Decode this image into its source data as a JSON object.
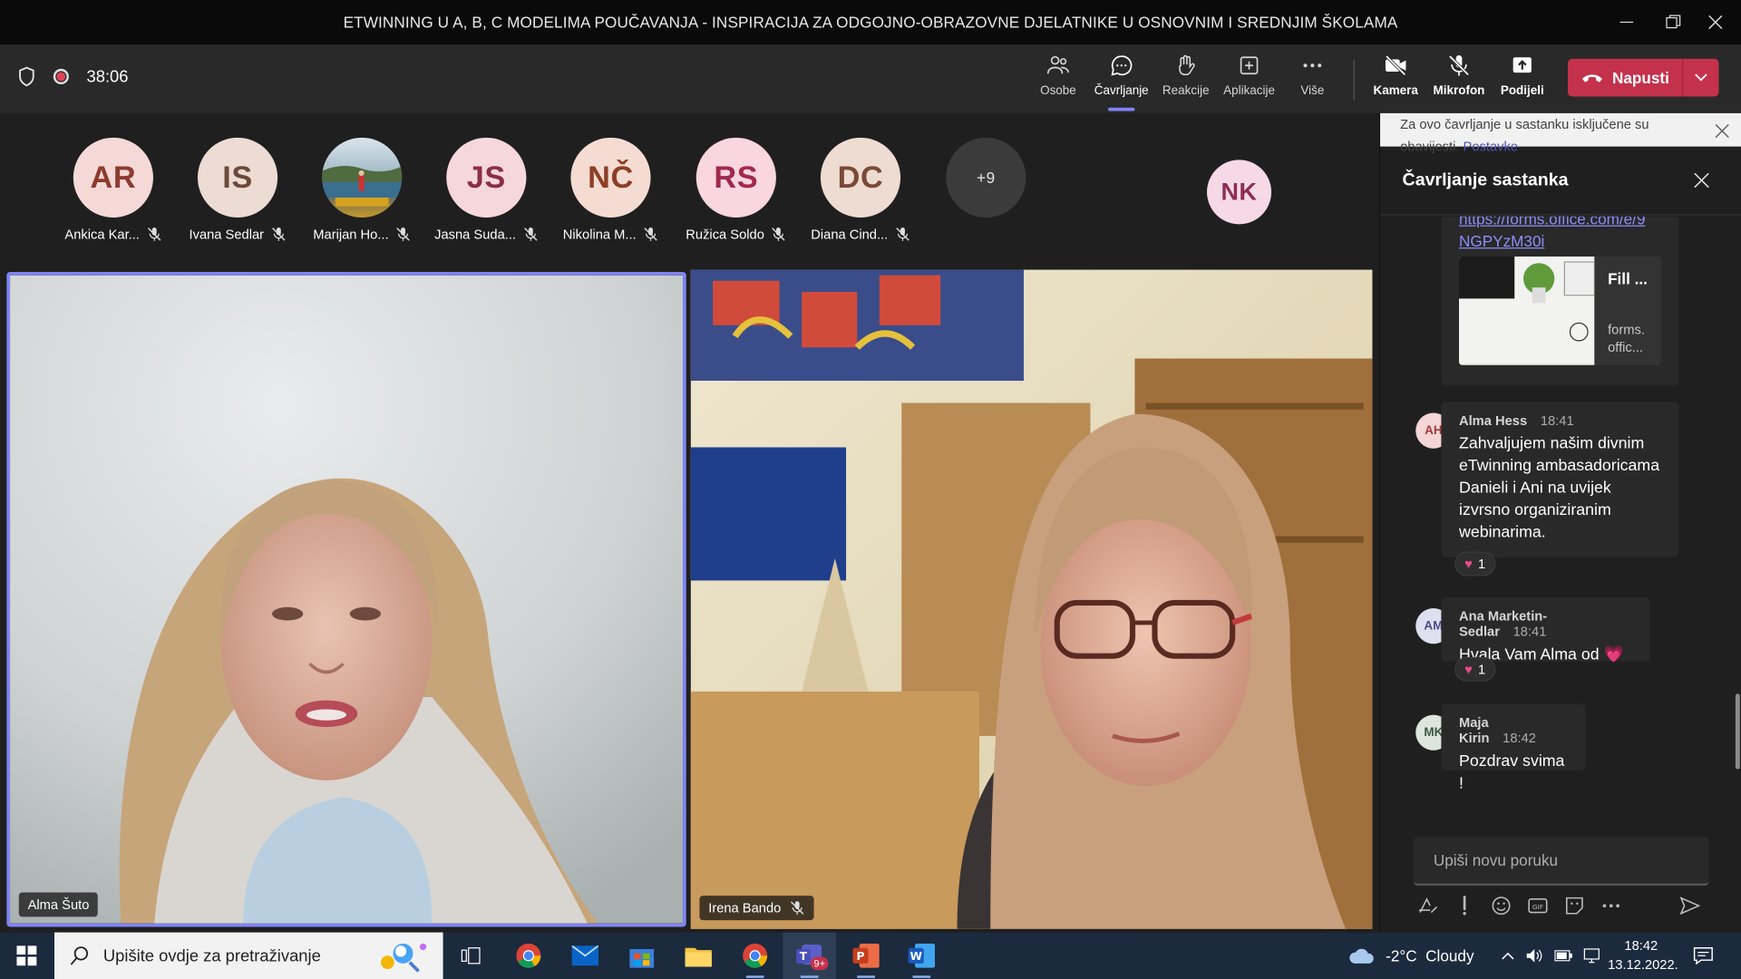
{
  "window": {
    "title": "ETWINNING U A, B, C MODELIMA POUČAVANJA - INSPIRACIJA ZA ODGOJNO-OBRAZOVNE DJELATNIKE U OSNOVNIM I SREDNJIM ŠKOLAMA"
  },
  "meeting": {
    "timer": "38:06"
  },
  "toolbar": {
    "people": "Osobe",
    "chat": "Čavrljanje",
    "reactions": "Reakcije",
    "apps": "Aplikacije",
    "more": "Više",
    "camera": "Kamera",
    "mic": "Mikrofon",
    "share": "Podijeli",
    "leave": "Napusti"
  },
  "participants": [
    {
      "initials": "AR",
      "name": "Ankica Kar...",
      "bg": "#f4d9d6",
      "fg": "#8e3a2f"
    },
    {
      "initials": "IS",
      "name": "Ivana Sedlar",
      "bg": "#ecdcd3",
      "fg": "#6b4a3a"
    },
    {
      "initials": "",
      "name": "Marijan Ho...",
      "bg": "#6a7e8c",
      "fg": "#ffffff"
    },
    {
      "initials": "JS",
      "name": "Jasna Suda...",
      "bg": "#f6d8dc",
      "fg": "#8a2f46"
    },
    {
      "initials": "NČ",
      "name": "Nikolina M...",
      "bg": "#f5dcd2",
      "fg": "#8d3e25"
    },
    {
      "initials": "RS",
      "name": "Ružica Soldo",
      "bg": "#f9d6e0",
      "fg": "#a0294f"
    },
    {
      "initials": "DC",
      "name": "Diana Cind...",
      "bg": "#eedcd2",
      "fg": "#7a4a36"
    }
  ],
  "overflow": {
    "count": "+9"
  },
  "self_avatar": {
    "initials": "NK"
  },
  "tiles": {
    "left": {
      "name": "Alma Šuto"
    },
    "right": {
      "name": "Irena Bando"
    }
  },
  "chat": {
    "notice_text": "Za ovo čavrljanje u sastanku isključene su obavijesti.",
    "notice_link": "Postavke",
    "title": "Čavrljanje sastanka",
    "link_text": "https://forms.office.com/e/9NGPYzM30i",
    "link_line1": "https://forms.office.com/e/9",
    "link_line2": "NGPYzM30i",
    "preview_title": "Fill ...",
    "preview_domain1": "forms.",
    "preview_domain2": "offic...",
    "messages": [
      {
        "initials": "AH",
        "author": "Alma Hess",
        "time": "18:41",
        "text": "Zahvaljujem našim divnim eTwinning ambasadoricama Danieli i Ani na uvijek izvrsno organiziranim webinarima.",
        "reaction_count": "1",
        "bg": "#f4d6d6",
        "fg": "#a23b3b"
      },
      {
        "initials": "AM",
        "author": "Ana Marketin-Sedlar",
        "time": "18:41",
        "text": "Hvala Vam Alma od 💗",
        "reaction_count": "1",
        "bg": "#dfe0ef",
        "fg": "#4b4f8a"
      },
      {
        "initials": "MK",
        "author": "Maja Kirin",
        "time": "18:42",
        "text": "Pozdrav svima !",
        "reaction_count": "",
        "bg": "#dde6de",
        "fg": "#3c5a40"
      }
    ],
    "compose_placeholder": "Upiši novu poruku"
  },
  "taskbar": {
    "search_placeholder": "Upišite ovdje za pretraživanje",
    "teams_badge": "9+",
    "weather": "-2°C  Cloudy",
    "time": "18:42",
    "date": "13.12.2022."
  },
  "colors": {
    "accent": "#7f85f5",
    "leave": "#c4314b",
    "active_speaker_border": "#7f85f5"
  }
}
